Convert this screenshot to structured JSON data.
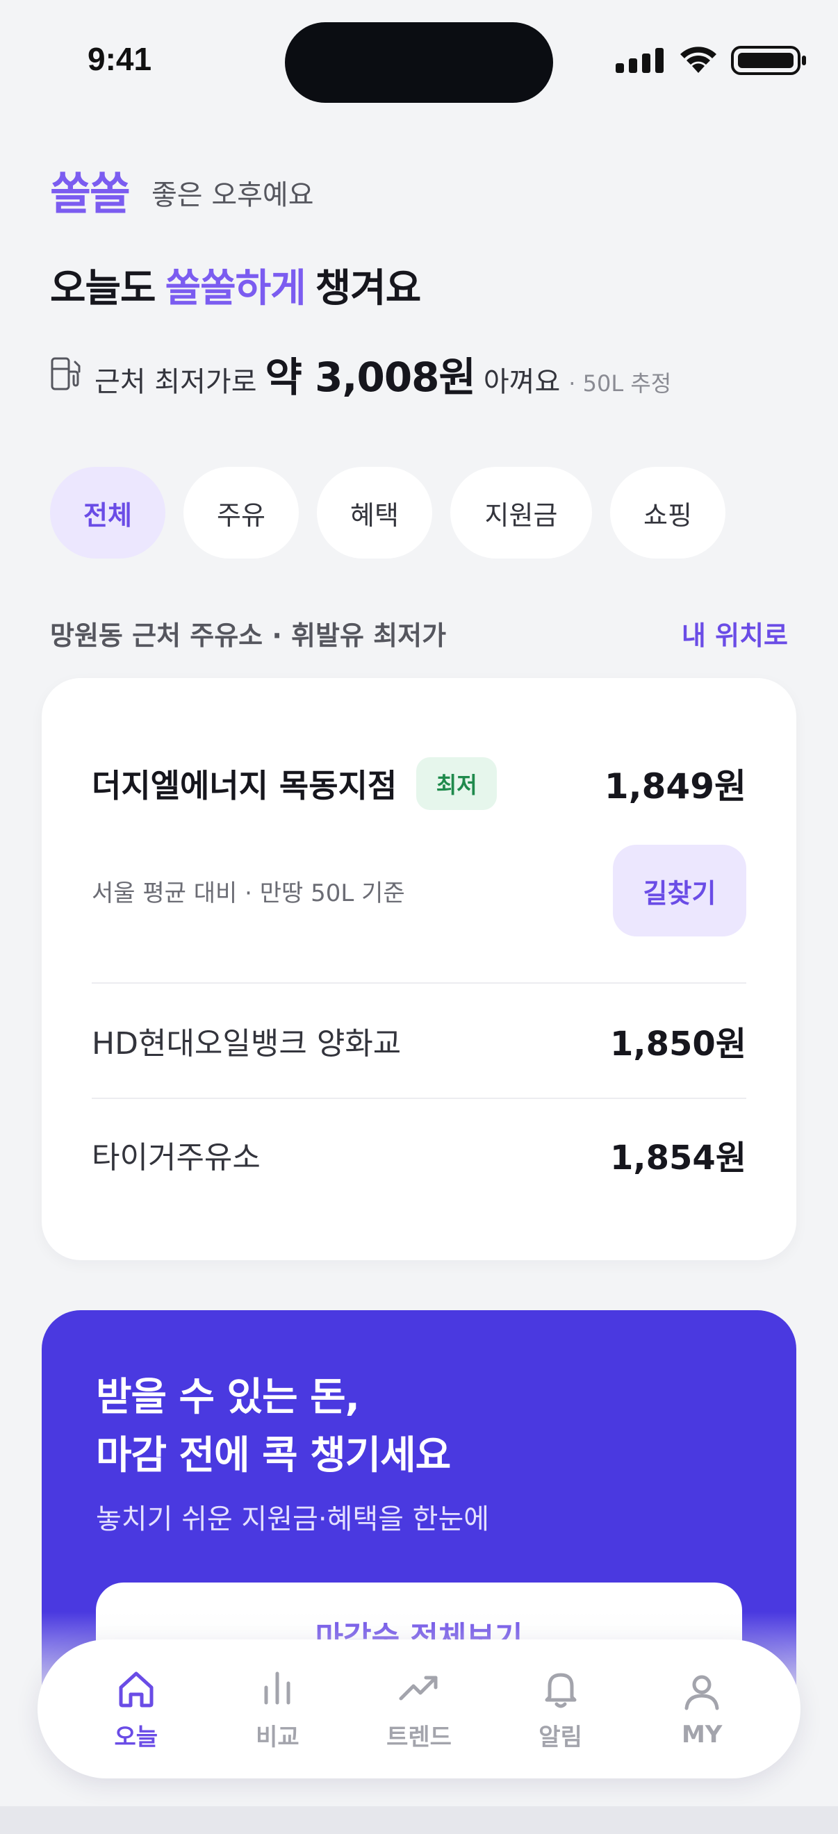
{
  "status_bar": {
    "time": "9:41"
  },
  "header": {
    "brand": "쏠쏠",
    "greeting": "좋은 오후예요",
    "headline_prefix": "오늘도",
    "headline_accent": "쏠쏠하게",
    "headline_suffix": "챙겨요",
    "savings_label": "근처 최저가로",
    "savings_amount": "약 3,008원",
    "savings_after": "아껴요",
    "savings_note": "· 50L 추정"
  },
  "chips": [
    {
      "label": "전체",
      "active": true
    },
    {
      "label": "주유",
      "active": false
    },
    {
      "label": "혜택",
      "active": false
    },
    {
      "label": "지원금",
      "active": false
    },
    {
      "label": "쇼핑",
      "active": false
    }
  ],
  "section": {
    "title": "망원동 근처 주유소 · 휘발유 최저가",
    "link": "내 위치로"
  },
  "stations": {
    "top": {
      "name": "더지엘에너지 목동지점",
      "badge": "최저",
      "price": "1,849원",
      "sub": "서울 평균 대비 · 만땅 50L 기준",
      "nav_button": "길찾기"
    },
    "others": [
      {
        "name": "HD현대오일뱅크 양화교",
        "price": "1,850원"
      },
      {
        "name": "타이거주유소",
        "price": "1,854원"
      }
    ]
  },
  "promo": {
    "title_line1": "받을 수 있는 돈,",
    "title_line2": "마감 전에 콕 챙기세요",
    "subtitle": "놓치기 쉬운 지원금·혜택을 한눈에",
    "button": "마감순 전체보기"
  },
  "tabbar": [
    {
      "label": "오늘",
      "icon": "home-icon",
      "active": true
    },
    {
      "label": "비교",
      "icon": "bar-chart-icon",
      "active": false
    },
    {
      "label": "트렌드",
      "icon": "trend-icon",
      "active": false
    },
    {
      "label": "알림",
      "icon": "bell-icon",
      "active": false
    },
    {
      "label": "MY",
      "icon": "person-icon",
      "active": false
    }
  ],
  "colors": {
    "accent": "#7b5cf0",
    "accent_dark": "#6a4ce6",
    "promo_bg": "#4a39e0",
    "badge_bg": "#e6f6ec",
    "badge_text": "#1f8a4c",
    "background": "#f3f4f6"
  }
}
